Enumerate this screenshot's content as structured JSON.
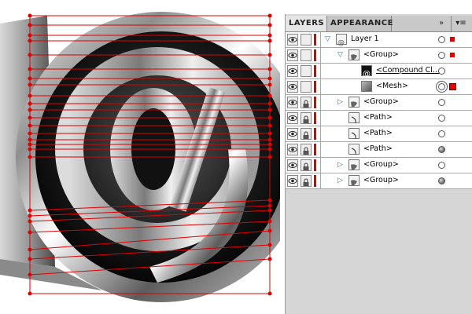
{
  "panel": {
    "tabs": [
      {
        "label": "LAYERS",
        "active": true
      },
      {
        "label": "APPEARANCE",
        "active": false
      }
    ],
    "buttons": {
      "collapse": "»",
      "menu": "▾≡"
    }
  },
  "layers": [
    {
      "label": "Layer 1",
      "indent": 0,
      "expanded": true,
      "thumb": "layer-thumb",
      "lock": false,
      "target": "hollow",
      "selected_marker": "small"
    },
    {
      "label": "<Group>",
      "indent": 1,
      "expanded": true,
      "thumb": "group-thumb",
      "lock": false,
      "target": "hollow",
      "selected_marker": "small"
    },
    {
      "label": "<Compound Cl...",
      "indent": 2,
      "expanded": null,
      "thumb": "compound-thumb",
      "lock": false,
      "target": "hollow",
      "selected_marker": "none",
      "underline": true
    },
    {
      "label": "<Mesh>",
      "indent": 2,
      "expanded": null,
      "thumb": "mesh-thumb",
      "lock": false,
      "target": "double",
      "selected_marker": "big"
    },
    {
      "label": "<Group>",
      "indent": 1,
      "expanded": false,
      "thumb": "group-thumb",
      "lock": true,
      "target": "hollow",
      "selected_marker": "none"
    },
    {
      "label": "<Path>",
      "indent": 1,
      "expanded": null,
      "thumb": "path-thumb",
      "lock": true,
      "target": "hollow",
      "selected_marker": "none"
    },
    {
      "label": "<Path>",
      "indent": 1,
      "expanded": null,
      "thumb": "path-thumb",
      "lock": true,
      "target": "hollow",
      "selected_marker": "none"
    },
    {
      "label": "<Path>",
      "indent": 1,
      "expanded": null,
      "thumb": "path-thumb",
      "lock": true,
      "target": "filled",
      "selected_marker": "none"
    },
    {
      "label": "<Group>",
      "indent": 1,
      "expanded": false,
      "thumb": "group-thumb",
      "lock": true,
      "target": "hollow",
      "selected_marker": "none"
    },
    {
      "label": "<Group>",
      "indent": 1,
      "expanded": false,
      "thumb": "group-thumb",
      "lock": true,
      "target": "filled",
      "selected_marker": "none"
    }
  ],
  "colors": {
    "selection": "#e00000",
    "panel_bg": "#d6d6d6",
    "row_bg": "#ffffff"
  },
  "canvas": {
    "artwork": "3D chrome @ symbol with mesh selection lines",
    "icon": "at-sign-icon"
  }
}
